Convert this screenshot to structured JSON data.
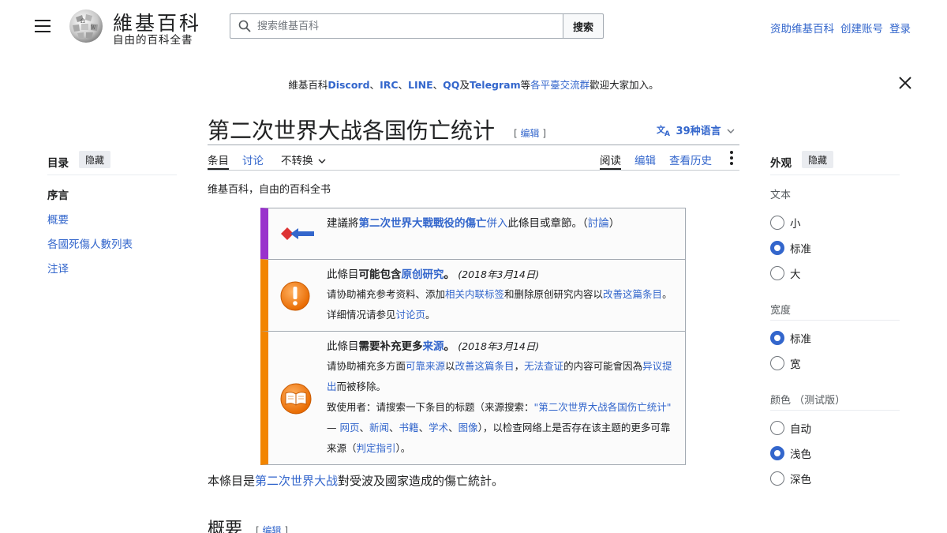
{
  "header": {
    "logo_title": "維基百科",
    "logo_tagline": "自由的百科全書",
    "search_placeholder": "搜索维基百科",
    "search_button": "搜索",
    "links": [
      "资助维基百科",
      "创建账号",
      "登录"
    ]
  },
  "banner": {
    "prefix": "維基百科",
    "discord": "Discord",
    "sep1": "、",
    "irc": "IRC",
    "sep2": "、",
    "line": "LINE",
    "sep3": "、",
    "qq": "QQ",
    "and": "及",
    "telegram": "Telegram",
    "mid": "等",
    "group_link": "各平臺交流群",
    "suffix": "歡迎大家加入。"
  },
  "article": {
    "title": "第二次世界大战各国伤亡统计",
    "edit_open": "[ ",
    "edit_label": "编辑",
    "edit_close": " ]",
    "languages": "39种语言",
    "subtitle": "维基百科，自由的百科全书",
    "tabs_left": [
      "条目",
      "讨论",
      "不转换"
    ],
    "tabs_right": [
      "阅读",
      "编辑",
      "查看历史"
    ]
  },
  "toc": {
    "heading": "目录",
    "hide": "隐藏",
    "items": [
      "序言",
      "概要",
      "各國死傷人數列表",
      "注译"
    ]
  },
  "appearance": {
    "heading": "外观",
    "hide": "隐藏",
    "text_label": "文本",
    "text_options": [
      "小",
      "标准",
      "大"
    ],
    "text_selected": "标准",
    "width_label": "宽度",
    "width_options": [
      "标准",
      "宽"
    ],
    "width_selected": "标准",
    "color_label": "颜色 （测试版）",
    "color_options": [
      "自动",
      "浅色",
      "深色"
    ],
    "color_selected": "浅色"
  },
  "notices": {
    "merge": {
      "t1": "建議將",
      "link": "第二次世界大戰戰役的傷亡",
      "t2": "併入",
      "t3": "此條目或章節。（",
      "discuss": "討論",
      "t4": "）"
    },
    "original_research": {
      "t1": "此條目",
      "bold": "可能包含",
      "link": "原创研究",
      "t2": "。",
      "date": "(2018年3月14日)",
      "l2a": "请协助補充参考资料、添加",
      "l2link": "相关内联标签",
      "l2b": "和删除原创研究内容以",
      "l2link2": "改善这篇条目",
      "l2c": "。详细情况请参见",
      "l2link3": "讨论页",
      "l2d": "。"
    },
    "sources": {
      "t1": "此條目",
      "bold": "需要补充更多",
      "link": "来源",
      "t2": "。",
      "date": "(2018年3月14日)",
      "l2a": "请协助補充多方面",
      "l2link": "可靠来源",
      "l2b": "以",
      "l2link2": "改善这篇条目",
      "l2c": "，",
      "l2link3": "无法查证",
      "l2d": "的内容可能會因為",
      "l2link4": "异议提出",
      "l2e": "而被移除。",
      "l3a": "致使用者：请搜索一下条目的标题（来源搜索：",
      "l3link": "\"第二次世界大战各国伤亡统计\"",
      "l3b": " — ",
      "web": "网页",
      "news": "新闻",
      "books": "书籍",
      "scholar": "学术",
      "images": "图像",
      "l3c": "），以检查网络上是否存在该主题的更多可靠来源（",
      "guide": "判定指引",
      "l3d": "）。"
    }
  },
  "body": {
    "p1a": "本條目是",
    "p1link": "第二次世界大战",
    "p1b": "對受波及國家造成的傷亡統計。",
    "section1": "概要",
    "section1_edit_open": "[ ",
    "section1_edit": "编辑",
    "section1_edit_close": " ]"
  }
}
